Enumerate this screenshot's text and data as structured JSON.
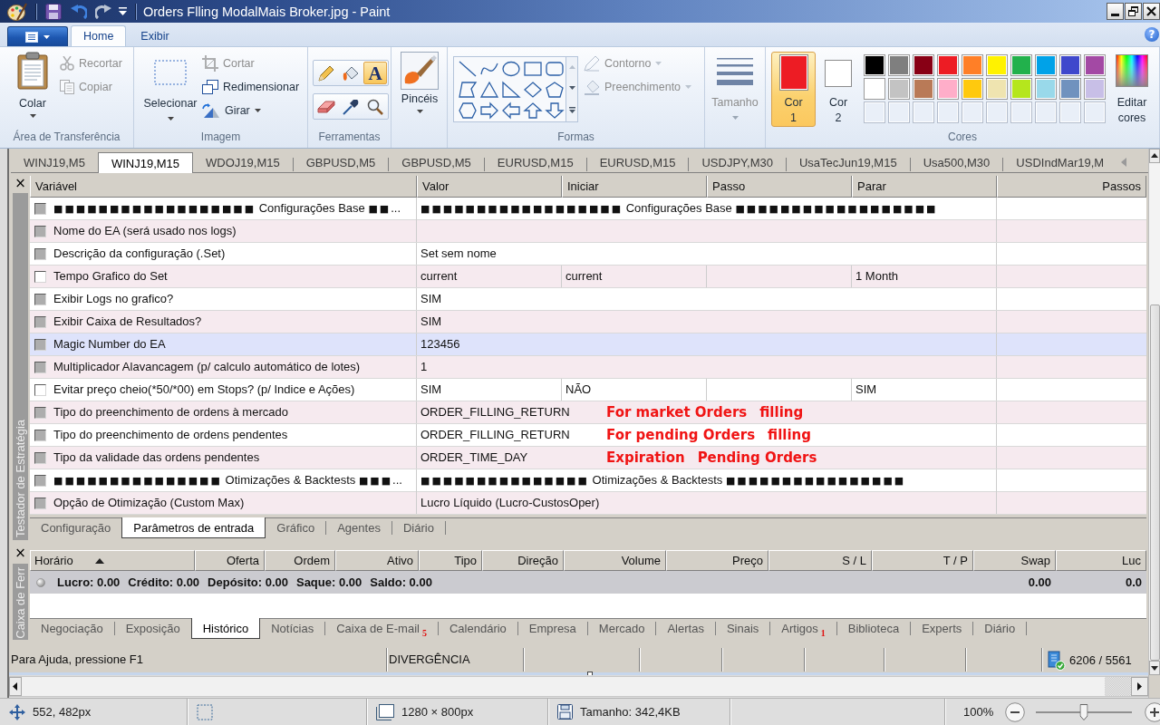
{
  "window": {
    "title": "Orders Flling ModalMais Broker.jpg - Paint"
  },
  "ribbon": {
    "tabs": [
      {
        "label": "Home",
        "selected": true
      },
      {
        "label": "Exibir",
        "selected": false
      }
    ],
    "help": "?",
    "clipboard": {
      "label": "Área de Transferência",
      "paste": "Colar",
      "actions": [
        {
          "label": "Recortar",
          "disabled": true
        },
        {
          "label": "Copiar",
          "disabled": true
        }
      ]
    },
    "image": {
      "label": "Imagem",
      "select": "Selecionar",
      "actions": [
        {
          "label": "Cortar",
          "disabled": true,
          "dropdown": false
        },
        {
          "label": "Redimensionar",
          "disabled": false,
          "dropdown": false
        },
        {
          "label": "Girar",
          "disabled": false,
          "dropdown": true
        }
      ]
    },
    "tools": {
      "label": "Ferramentas",
      "items": [
        {
          "selected": false
        },
        {
          "selected": false
        },
        {
          "selected": true,
          "glyph": "A"
        },
        {
          "selected": false
        },
        {
          "selected": false
        },
        {
          "selected": false
        }
      ]
    },
    "brushes": {
      "label": "Pincéis"
    },
    "shapes": {
      "label": "Formas",
      "options": [
        {
          "label": "Contorno",
          "disabled": true
        },
        {
          "label": "Preenchimento",
          "disabled": true
        }
      ]
    },
    "size": {
      "label": "Tamanho",
      "disabled": true
    },
    "colors": {
      "label": "Cores",
      "current": [
        {
          "label": "Cor 1",
          "color": "#ed1c24",
          "selected": true
        },
        {
          "label": "Cor 2",
          "color": "#ffffff",
          "selected": false
        }
      ],
      "palette": [
        {
          "color": "#000000"
        },
        {
          "color": "#7f7f7f"
        },
        {
          "color": "#880015"
        },
        {
          "color": "#ed1c24"
        },
        {
          "color": "#ff7f27"
        },
        {
          "color": "#fff200"
        },
        {
          "color": "#22b14c"
        },
        {
          "color": "#00a2e8"
        },
        {
          "color": "#3f48cc"
        },
        {
          "color": "#a349a4"
        },
        {
          "color": "#ffffff"
        },
        {
          "color": "#c3c3c3"
        },
        {
          "color": "#b97a57"
        },
        {
          "color": "#ffaec9"
        },
        {
          "color": "#ffc90e"
        },
        {
          "color": "#efe4b0"
        },
        {
          "color": "#b5e61d"
        },
        {
          "color": "#99d9ea"
        },
        {
          "color": "#7092be"
        },
        {
          "color": "#c8bfe7"
        }
      ],
      "edit": "Editar cores"
    }
  },
  "terminal": {
    "chart_tabs": [
      {
        "label": "WINJ19,M5",
        "selected": false
      },
      {
        "label": "WINJ19,M15",
        "selected": true
      },
      {
        "label": "WDOJ19,M15",
        "selected": false
      },
      {
        "label": "GBPUSD,M5",
        "selected": false
      },
      {
        "label": "GBPUSD,M5",
        "selected": false
      },
      {
        "label": "EURUSD,M15",
        "selected": false
      },
      {
        "label": "EURUSD,M15",
        "selected": false
      },
      {
        "label": "USDJPY,M30",
        "selected": false
      },
      {
        "label": "UsaTecJun19,M15",
        "selected": false
      },
      {
        "label": "Usa500,M30",
        "selected": false
      },
      {
        "label": "USDIndMar19,M",
        "selected": false
      }
    ],
    "tester": {
      "close": "×",
      "side_tab": "Testador de Estratégia",
      "columns": [
        "Variável",
        "Valor",
        "Iniciar",
        "Passo",
        "Parar",
        "Passos"
      ],
      "rows": [
        {
          "variable": "■■■■■■■■■■■■■■■■■■ Configurações Base ■■...",
          "value": "■■■■■■■■■■■■■■■■■■ Configurações Base ■■■■■■■■■■■■■■■■■■",
          "checked": false,
          "disabled": true,
          "selected": false
        },
        {
          "variable": "Nome do EA (será usado nos logs)",
          "checked": false,
          "disabled": true,
          "selected": false
        },
        {
          "variable": "Descrição da configuração (.Set)",
          "value": "Set sem nome",
          "checked": false,
          "disabled": true,
          "selected": false
        },
        {
          "variable": "Tempo Grafico do Set",
          "value": "current",
          "start": "current",
          "stop": "1 Month",
          "checked": false,
          "disabled": false,
          "selected": false
        },
        {
          "variable": "Exibir Logs no grafico?",
          "value": "SIM",
          "checked": false,
          "disabled": true,
          "selected": false
        },
        {
          "variable": "Exibir Caixa de Resultados?",
          "value": "SIM",
          "checked": false,
          "disabled": true,
          "selected": false
        },
        {
          "variable": "Magic Number do EA",
          "value": "123456",
          "checked": false,
          "disabled": true,
          "selected": true
        },
        {
          "variable": "Multiplicador Alavancagem (p/ calculo automático de lotes)",
          "value": "1",
          "checked": false,
          "disabled": true,
          "selected": false
        },
        {
          "variable": "Evitar preço cheio(*50/*00) em Stops? (p/ Indice e Ações)",
          "value": "SIM",
          "start": "NÃO",
          "stop": "SIM",
          "checked": false,
          "disabled": false,
          "selected": false
        },
        {
          "variable": "Tipo do preenchimento de ordens à mercado",
          "value": "ORDER_FILLING_RETURN",
          "checked": false,
          "disabled": true,
          "selected": false,
          "note": [
            "For market Orders",
            "filling"
          ]
        },
        {
          "variable": "Tipo do preenchimento de ordens pendentes",
          "value": "ORDER_FILLING_RETURN",
          "checked": false,
          "disabled": true,
          "selected": false,
          "note": [
            "For pending Orders",
            "filling"
          ]
        },
        {
          "variable": "Tipo da validade das ordens pendentes",
          "value": "ORDER_TIME_DAY",
          "checked": false,
          "disabled": true,
          "selected": false,
          "note": [
            "Expiration",
            "Pending Orders"
          ]
        },
        {
          "variable": "■■■■■■■■■■■■■■■ Otimizações & Backtests ■■■...",
          "value": "■■■■■■■■■■■■■■■ Otimizações & Backtests ■■■■■■■■■■■■■■■■",
          "checked": false,
          "disabled": true,
          "selected": false
        },
        {
          "variable": "Opção de Otimização (Custom Max)",
          "value": "Lucro Líquido (Lucro-CustosOper)",
          "checked": false,
          "disabled": true,
          "selected": false
        }
      ],
      "tabs": [
        {
          "label": "Configuração",
          "selected": false
        },
        {
          "label": "Parâmetros de entrada",
          "selected": true
        },
        {
          "label": "Gráfico",
          "selected": false
        },
        {
          "label": "Agentes",
          "selected": false
        },
        {
          "label": "Diário",
          "selected": false
        }
      ]
    },
    "toolbox": {
      "close": "×",
      "side_tab": "Caixa de Ferr",
      "columns": [
        {
          "label": "Horário",
          "sorted": true
        },
        {
          "label": "Oferta",
          "sorted": false
        },
        {
          "label": "Ordem",
          "sorted": false
        },
        {
          "label": "Ativo",
          "sorted": false
        },
        {
          "label": "Tipo",
          "sorted": false
        },
        {
          "label": "Direção",
          "sorted": false
        },
        {
          "label": "Volume",
          "sorted": false
        },
        {
          "label": "Preço",
          "sorted": false
        },
        {
          "label": "S / L",
          "sorted": false
        },
        {
          "label": "T / P",
          "sorted": false
        },
        {
          "label": "Swap",
          "sorted": false
        },
        {
          "label": "Luc",
          "sorted": false
        }
      ],
      "summary": [
        "Lucro: 0.00",
        "Crédito: 0.00",
        "Depósito: 0.00",
        "Saque: 0.00",
        "Saldo: 0.00"
      ],
      "swap": "0.00",
      "profit": "0.0",
      "tabs": [
        {
          "label": "Negociação",
          "selected": false
        },
        {
          "label": "Exposição",
          "selected": false
        },
        {
          "label": "Histórico",
          "selected": true
        },
        {
          "label": "Notícias",
          "selected": false
        },
        {
          "label": "Caixa de E-mail",
          "badge": "5",
          "selected": false
        },
        {
          "label": "Calendário",
          "selected": false
        },
        {
          "label": "Empresa",
          "selected": false
        },
        {
          "label": "Mercado",
          "selected": false
        },
        {
          "label": "Alertas",
          "selected": false
        },
        {
          "label": "Sinais",
          "selected": false
        },
        {
          "label": "Artigos",
          "badge": "1",
          "selected": false
        },
        {
          "label": "Biblioteca",
          "selected": false
        },
        {
          "label": "Experts",
          "selected": false
        },
        {
          "label": "Diário",
          "selected": false
        }
      ]
    },
    "status_bar": {
      "panels": [
        "Para Ajuda, pressione F1",
        "DIVERGÊNCIA"
      ],
      "server": "6206 / 5561"
    }
  },
  "paint_status": {
    "cursor": "552, 482px",
    "canvas_size": "1280 × 800px",
    "file_size": "Tamanho: 342,4KB",
    "zoom": {
      "reading": "100%",
      "level": 0.5
    }
  }
}
